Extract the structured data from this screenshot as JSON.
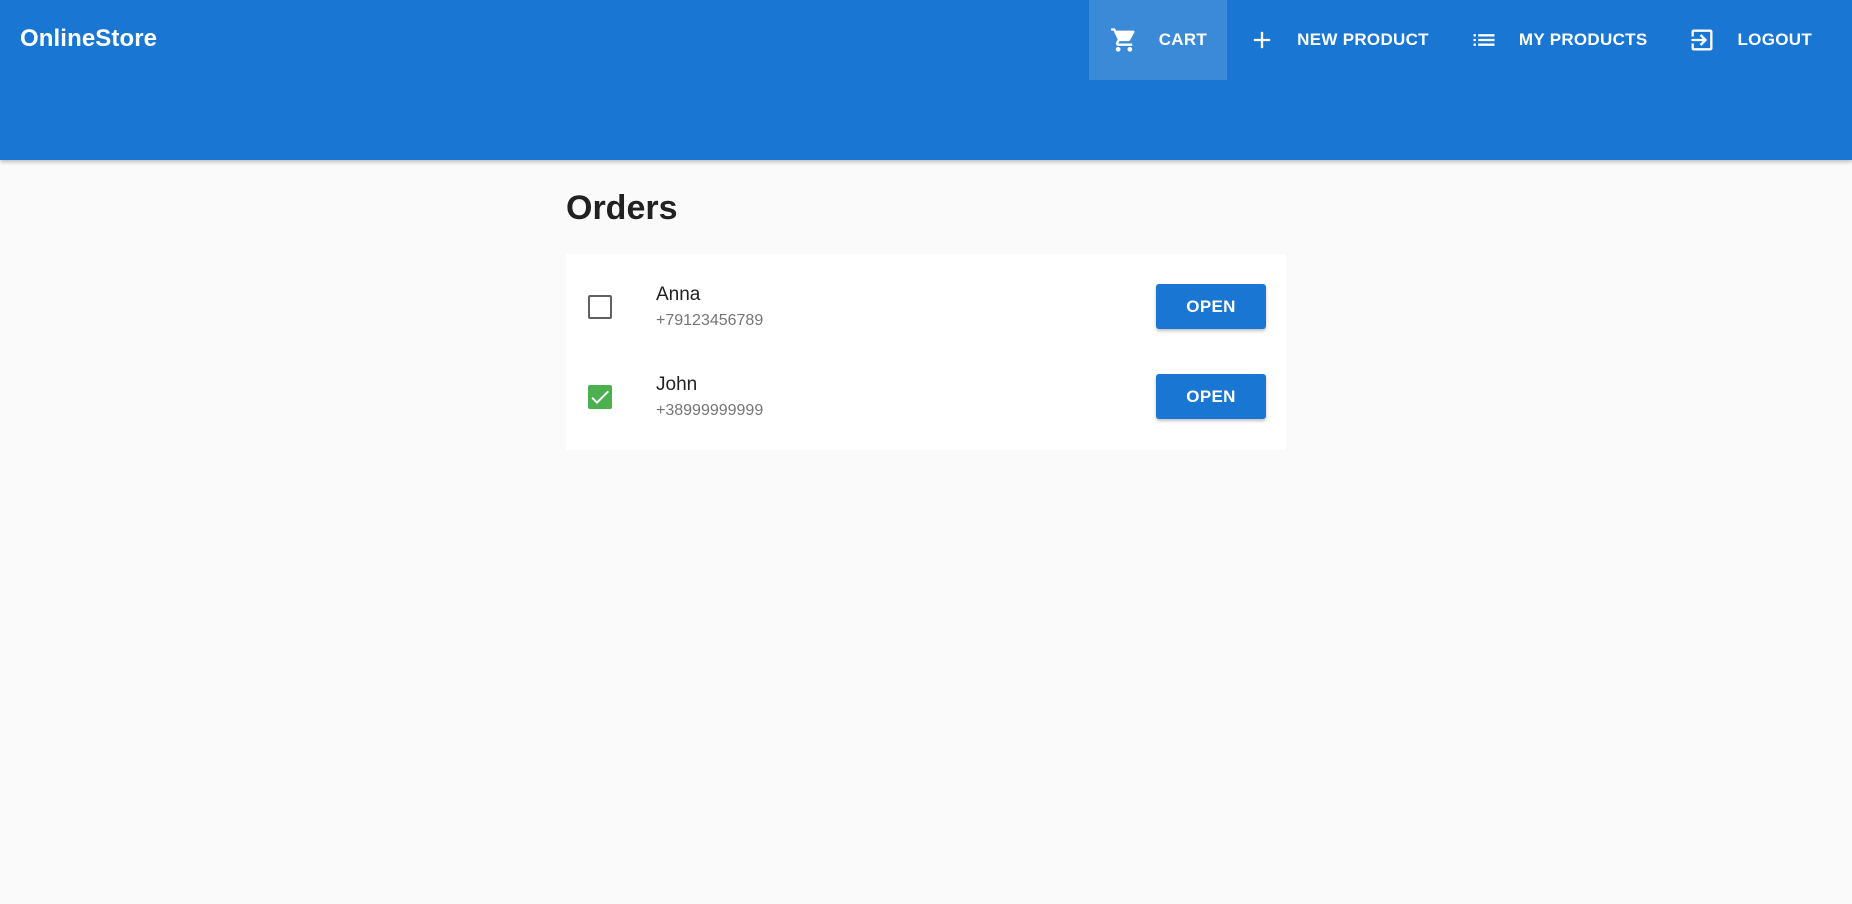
{
  "app": {
    "brand": "OnlineStore",
    "primary_color": "#1976d2"
  },
  "nav": {
    "items": [
      {
        "label": "CART",
        "icon": "cart-icon",
        "active": true
      },
      {
        "label": "NEW PRODUCT",
        "icon": "plus-icon",
        "active": false
      },
      {
        "label": "MY PRODUCTS",
        "icon": "list-icon",
        "active": false
      },
      {
        "label": "LOGOUT",
        "icon": "logout-icon",
        "active": false
      }
    ]
  },
  "page": {
    "title": "Orders"
  },
  "orders": [
    {
      "name": "Anna",
      "phone": "+79123456789",
      "checked": false,
      "action_label": "OPEN"
    },
    {
      "name": "John",
      "phone": "+38999999999",
      "checked": true,
      "action_label": "OPEN"
    }
  ],
  "colors": {
    "checked_green": "#4caf50"
  }
}
